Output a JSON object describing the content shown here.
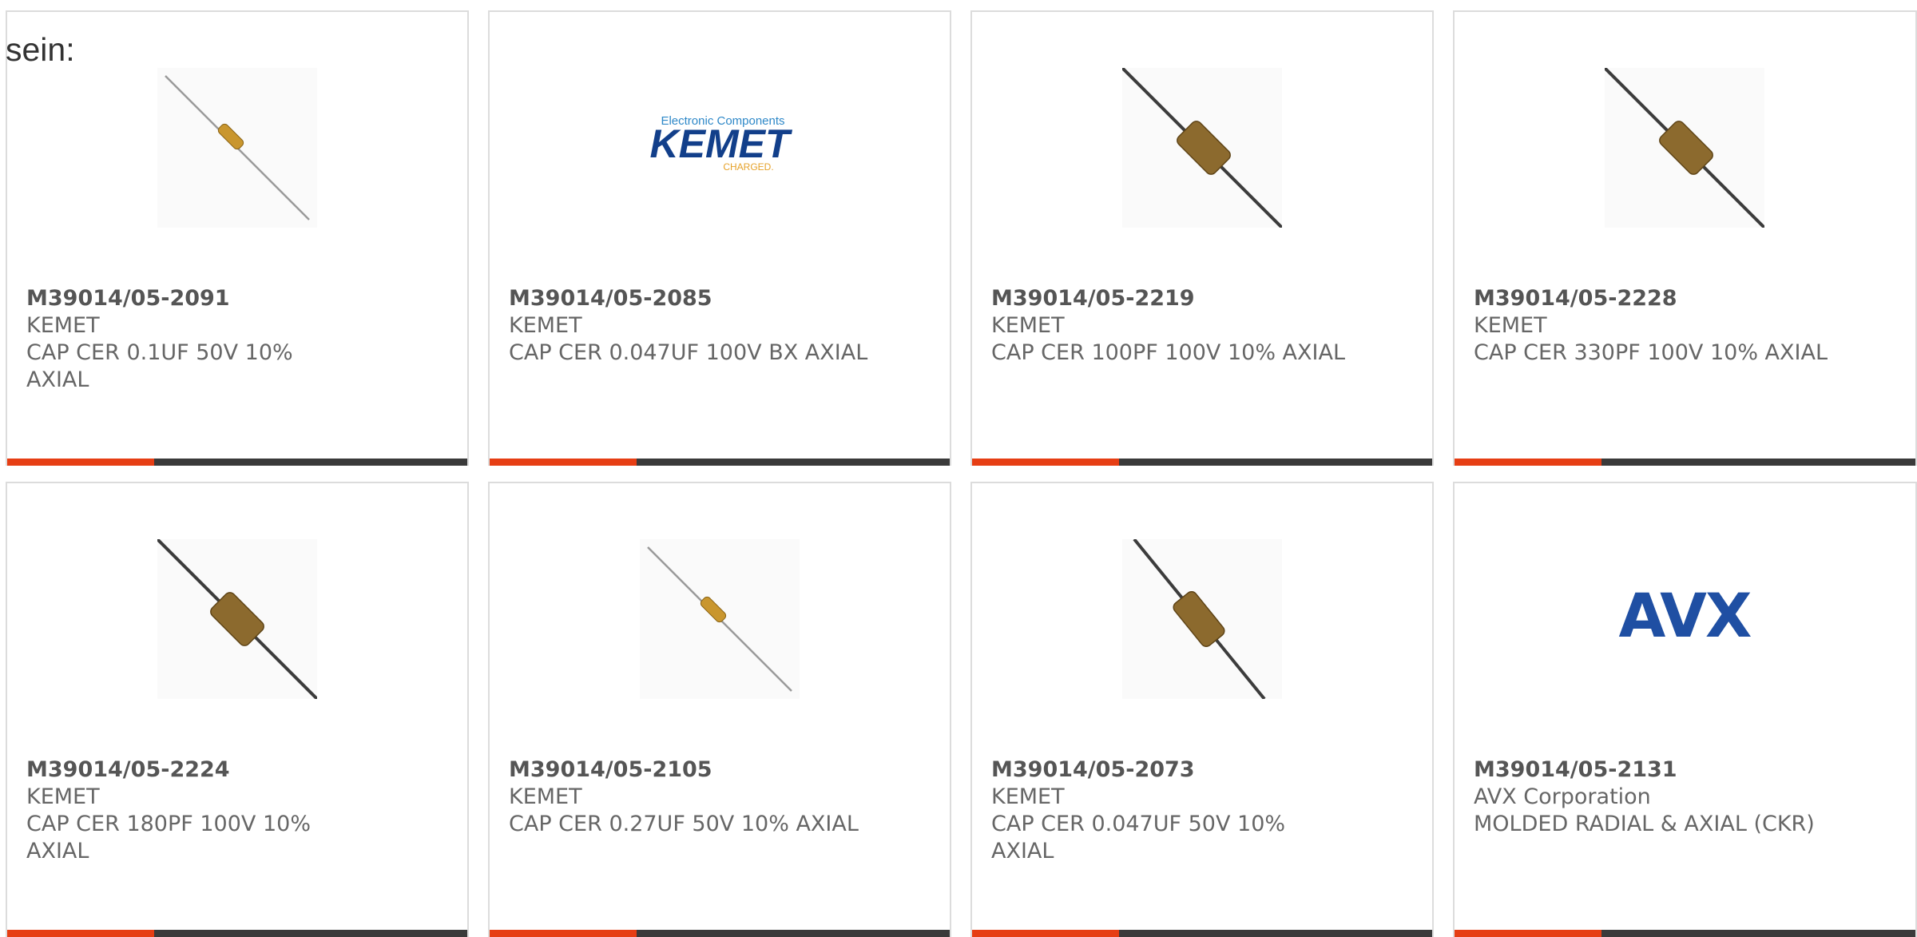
{
  "lead_text": "sein:",
  "colors": {
    "accent": "#e63e14",
    "bar": "#3a3a3a",
    "border": "#dcdcdc",
    "text": "#666666"
  },
  "products": [
    {
      "part_number": "M39014/05-2091",
      "manufacturer": "KEMET",
      "description": "CAP CER 0.1UF 50V 10% AXIAL",
      "image": "capacitor-thin-icon"
    },
    {
      "part_number": "M39014/05-2085",
      "manufacturer": "KEMET",
      "description": "CAP CER 0.047UF 100V BX AXIAL",
      "image": "kemet-logo",
      "logo_text": {
        "top": "Electronic Components",
        "main": "KEMET",
        "sub": "CHARGED."
      }
    },
    {
      "part_number": "M39014/05-2219",
      "manufacturer": "KEMET",
      "description": "CAP CER 100PF 100V 10% AXIAL",
      "image": "capacitor-thick-icon"
    },
    {
      "part_number": "M39014/05-2228",
      "manufacturer": "KEMET",
      "description": "CAP CER 330PF 100V 10% AXIAL",
      "image": "capacitor-thick-icon"
    },
    {
      "part_number": "M39014/05-2224",
      "manufacturer": "KEMET",
      "description": "CAP CER 180PF 100V 10% AXIAL",
      "image": "capacitor-thick-icon"
    },
    {
      "part_number": "M39014/05-2105",
      "manufacturer": "KEMET",
      "description": "CAP CER 0.27UF 50V 10% AXIAL",
      "image": "capacitor-thin-icon"
    },
    {
      "part_number": "M39014/05-2073",
      "manufacturer": "KEMET",
      "description": "CAP CER 0.047UF 50V 10% AXIAL",
      "image": "capacitor-steep-icon"
    },
    {
      "part_number": "M39014/05-2131",
      "manufacturer": "AVX Corporation",
      "description": "MOLDED RADIAL & AXIAL (CKR)",
      "image": "avx-logo",
      "logo_text": {
        "main": "AVX"
      }
    }
  ]
}
